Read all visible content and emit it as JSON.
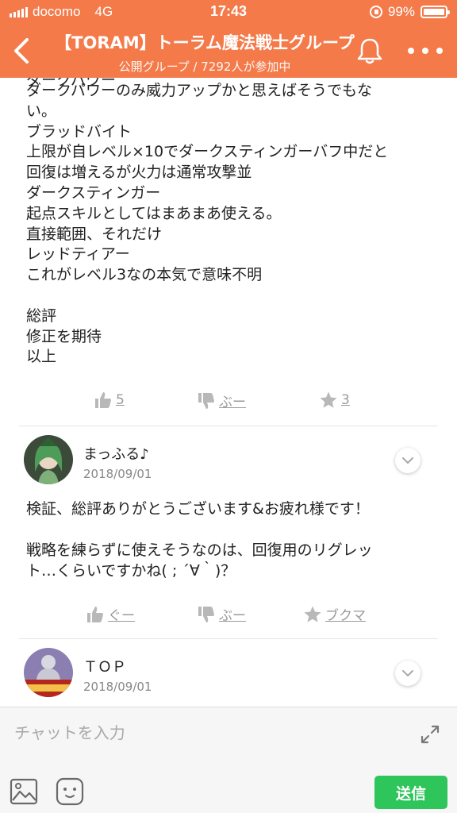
{
  "status_bar": {
    "carrier": "docomo",
    "network": "4G",
    "time": "17:43",
    "battery": "99%",
    "battery_level": 0.99
  },
  "header": {
    "title": "【TORAM】トーラム魔法戦士グループ",
    "subtitle": "公開グループ / 7292人が参加中"
  },
  "post": {
    "partial_line": "ダークパワー",
    "lines": [
      "ダークパワーのみ威力アップかと思えばそうでもな",
      "い。",
      "ブラッドバイト",
      "上限が自レベル×10でダークスティンガーバフ中だと",
      "回復は増えるが火力は通常攻撃並",
      "ダークスティンガー",
      "起点スキルとしてはまあまあ使える。",
      "直接範囲、それだけ",
      "レッドティアー",
      "これがレベル3なの本気で意味不明",
      "",
      "総評",
      "修正を期待",
      "以上"
    ],
    "actions": {
      "like": "5",
      "dislike": "ぶー",
      "bookmark": "3"
    }
  },
  "comments": [
    {
      "name": "まっふる♪",
      "date": "2018/09/01",
      "lines": [
        "検証、総評ありがとうございます&お疲れ様です！",
        "",
        "戦略を練らずに使えそうなのは、回復用のリグレッ",
        "ト…くらいですかね( ; ´∀｀)？"
      ],
      "actions": {
        "like": "ぐー",
        "dislike": "ぶー",
        "bookmark": "ブクマ"
      }
    },
    {
      "name": "ＴＯＰ",
      "date": "2018/09/01"
    }
  ],
  "input_bar": {
    "placeholder": "チャットを入力",
    "send_label": "送信"
  },
  "colors": {
    "header": "#f47a4a",
    "send": "#2ec55a",
    "action": "#9a9a9a"
  }
}
